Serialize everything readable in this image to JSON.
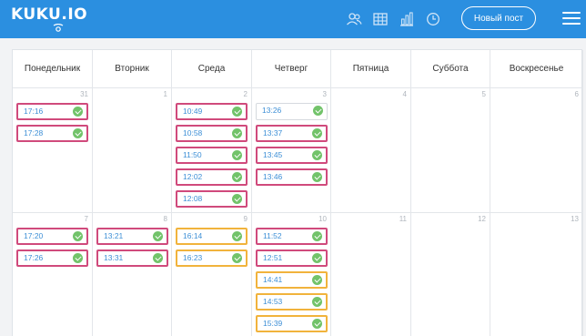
{
  "app": {
    "logo": "KUKU.IO"
  },
  "header": {
    "icons": [
      "users-icon",
      "table-icon",
      "chart-icon",
      "clock-icon"
    ],
    "new_post_label": "Новый пост"
  },
  "calendar": {
    "weekdays": [
      "Понедельник",
      "Вторник",
      "Среда",
      "Четверг",
      "Пятница",
      "Суббота",
      "Воскресенье"
    ],
    "weeks": [
      [
        {
          "day": "31",
          "posts": [
            {
              "time": "17:16",
              "status": "pink"
            },
            {
              "time": "17:28",
              "status": "pink"
            }
          ]
        },
        {
          "day": "1",
          "posts": []
        },
        {
          "day": "2",
          "posts": [
            {
              "time": "10:49",
              "status": "pink"
            },
            {
              "time": "10:58",
              "status": "pink"
            },
            {
              "time": "11:50",
              "status": "pink"
            },
            {
              "time": "12:02",
              "status": "pink"
            },
            {
              "time": "12:08",
              "status": "pink"
            }
          ]
        },
        {
          "day": "3",
          "posts": [
            {
              "time": "13:26",
              "status": "plain"
            },
            {
              "time": "13:37",
              "status": "pink"
            },
            {
              "time": "13:45",
              "status": "pink"
            },
            {
              "time": "13:46",
              "status": "pink"
            }
          ]
        },
        {
          "day": "4",
          "posts": []
        },
        {
          "day": "5",
          "posts": []
        },
        {
          "day": "6",
          "posts": []
        }
      ],
      [
        {
          "day": "7",
          "posts": [
            {
              "time": "17:20",
              "status": "pink"
            },
            {
              "time": "17:26",
              "status": "pink"
            }
          ]
        },
        {
          "day": "8",
          "posts": [
            {
              "time": "13:21",
              "status": "pink"
            },
            {
              "time": "13:31",
              "status": "pink"
            }
          ]
        },
        {
          "day": "9",
          "posts": [
            {
              "time": "16:14",
              "status": "orange"
            },
            {
              "time": "16:23",
              "status": "orange"
            }
          ]
        },
        {
          "day": "10",
          "posts": [
            {
              "time": "11:52",
              "status": "pink"
            },
            {
              "time": "12:51",
              "status": "pink"
            },
            {
              "time": "14:41",
              "status": "orange"
            },
            {
              "time": "14:53",
              "status": "orange"
            },
            {
              "time": "15:39",
              "status": "orange"
            }
          ]
        },
        {
          "day": "11",
          "posts": []
        },
        {
          "day": "12",
          "posts": []
        },
        {
          "day": "13",
          "posts": []
        }
      ]
    ]
  },
  "colors": {
    "header_bg": "#2b8fe0",
    "pink": "#d04a7c",
    "orange": "#f1b33c",
    "check": "#72c36a",
    "time_text": "#3d8fd6"
  }
}
